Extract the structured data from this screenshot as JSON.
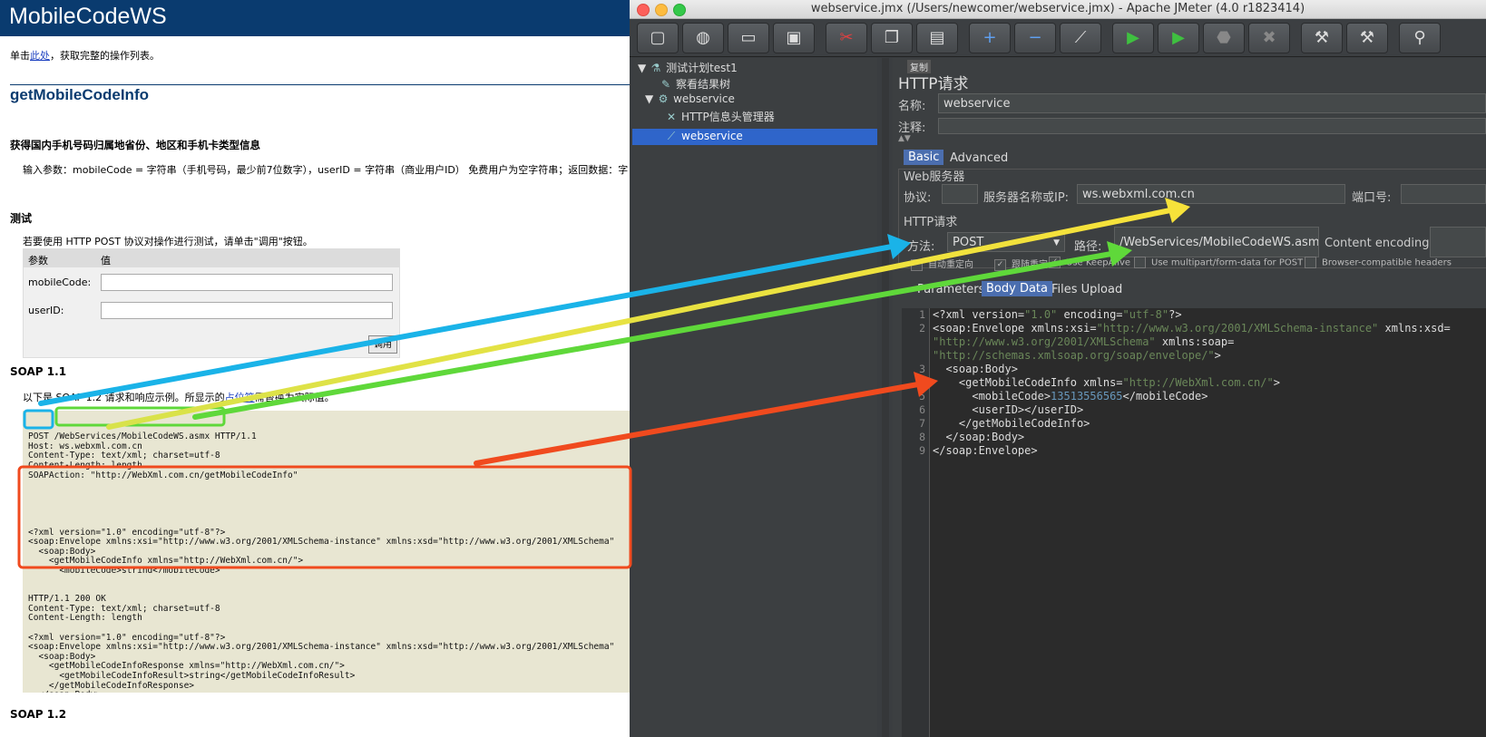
{
  "webpage": {
    "header_title": "MobileCodeWS",
    "intro_prefix": "单击",
    "intro_link": "此处",
    "intro_suffix": "，获取完整的操作列表。",
    "operation_title": "getMobileCodeInfo",
    "operation_desc": "获得国内手机号码归属地省份、地区和手机卡类型信息",
    "input_params": "输入参数：mobileCode = 字符串（手机号码，最少前7位数字），userID = 字符串（商业用户ID） 免费用户为空字符串；返回数据：字",
    "test_heading": "测试",
    "test_desc": "若要使用 HTTP POST 协议对操作进行测试，请单击\"调用\"按钮。",
    "param_col": "参数",
    "value_col": "值",
    "param_1": "mobileCode:",
    "param_2": "userID:",
    "invoke_button": "调用",
    "soap11_heading": "SOAP 1.1",
    "soap11_desc_prefix": "以下是 SOAP 1.2 请求和响应示例。所显示的",
    "soap11_desc_link": "占位符",
    "soap11_desc_suffix": "需替换为实际值。",
    "soap12_heading": "SOAP 1.2",
    "request_head": [
      "POST /WebServices/MobileCodeWS.asmx HTTP/1.1",
      "Host: ws.webxml.com.cn",
      "Content-Type: text/xml; charset=utf-8",
      "Content-Length: length",
      "SOAPAction: \"http://WebXml.com.cn/getMobileCodeInfo\""
    ],
    "request_body": [
      "<?xml version=\"1.0\" encoding=\"utf-8\"?>",
      "<soap:Envelope xmlns:xsi=\"http://www.w3.org/2001/XMLSchema-instance\" xmlns:xsd=\"http://www.w3.org/2001/XMLSchema\"",
      "  <soap:Body>",
      "    <getMobileCodeInfo xmlns=\"http://WebXml.com.cn/\">",
      "      <mobileCode>string</mobileCode>",
      "      <userID>string</userID>",
      "    </getMobileCodeInfo>",
      "  </soap:Body>",
      "</soap:Envelope>"
    ],
    "response": [
      "HTTP/1.1 200 OK",
      "Content-Type: text/xml; charset=utf-8",
      "Content-Length: length",
      "",
      "<?xml version=\"1.0\" encoding=\"utf-8\"?>",
      "<soap:Envelope xmlns:xsi=\"http://www.w3.org/2001/XMLSchema-instance\" xmlns:xsd=\"http://www.w3.org/2001/XMLSchema\"",
      "  <soap:Body>",
      "    <getMobileCodeInfoResponse xmlns=\"http://WebXml.com.cn/\">",
      "      <getMobileCodeInfoResult>string</getMobileCodeInfoResult>",
      "    </getMobileCodeInfoResponse>",
      "  </soap:Body>",
      "</soap:Envelope>"
    ]
  },
  "jmeter": {
    "window_title": "webservice.jmx (/Users/newcomer/webservice.jmx) - Apache JMeter (4.0 r1823414)",
    "toolbar_icons": [
      "new-icon",
      "templates-icon",
      "open-icon",
      "save-icon",
      "cut-icon",
      "copy-icon",
      "paste-icon",
      "expand-icon",
      "collapse-icon",
      "toggle-icon",
      "start-icon",
      "start-no-pause-icon",
      "stop-icon",
      "shutdown-icon",
      "clear-icon",
      "clear-all-icon",
      "search-icon"
    ],
    "tree": {
      "test_plan": "测试计划test1",
      "results_tree": "察看结果树",
      "thread_group": "webservice",
      "header_manager": "HTTP信息头管理器",
      "sampler": "webservice"
    },
    "tooltip": "复制",
    "panel_title": "HTTP请求",
    "name_label": "名称:",
    "name_value": "webservice",
    "comment_label": "注释:",
    "tabs": [
      "Basic",
      "Advanced"
    ],
    "web_server_section": "Web服务器",
    "protocol_label": "协议:",
    "protocol_value": "",
    "server_label": "服务器名称或IP:",
    "server_value": "ws.webxml.com.cn",
    "port_label": "端口号:",
    "http_request_section": "HTTP请求",
    "method_label": "方法:",
    "method_value": "POST",
    "path_label": "路径:",
    "path_value": "/WebServices/MobileCodeWS.asmx",
    "encoding_label": "Content encoding:",
    "checkboxes": [
      {
        "label": "自动重定向",
        "checked": false
      },
      {
        "label": "跟随重定向",
        "checked": true
      },
      {
        "label": "Use KeepAlive",
        "checked": true
      },
      {
        "label": "Use multipart/form-data for POST",
        "checked": false
      },
      {
        "label": "Browser-compatible headers",
        "checked": false
      }
    ],
    "body_tabs": [
      "Parameters",
      "Body Data",
      "Files Upload"
    ],
    "line_numbers": [
      "1",
      "2",
      "",
      "",
      "3",
      "4",
      "5",
      "6",
      "7",
      "8",
      "9"
    ]
  },
  "annotations": {
    "cyan": "#1ab3e8",
    "yellow": "#f3e13a",
    "green": "#5fd83a",
    "red": "#f04a1e"
  }
}
